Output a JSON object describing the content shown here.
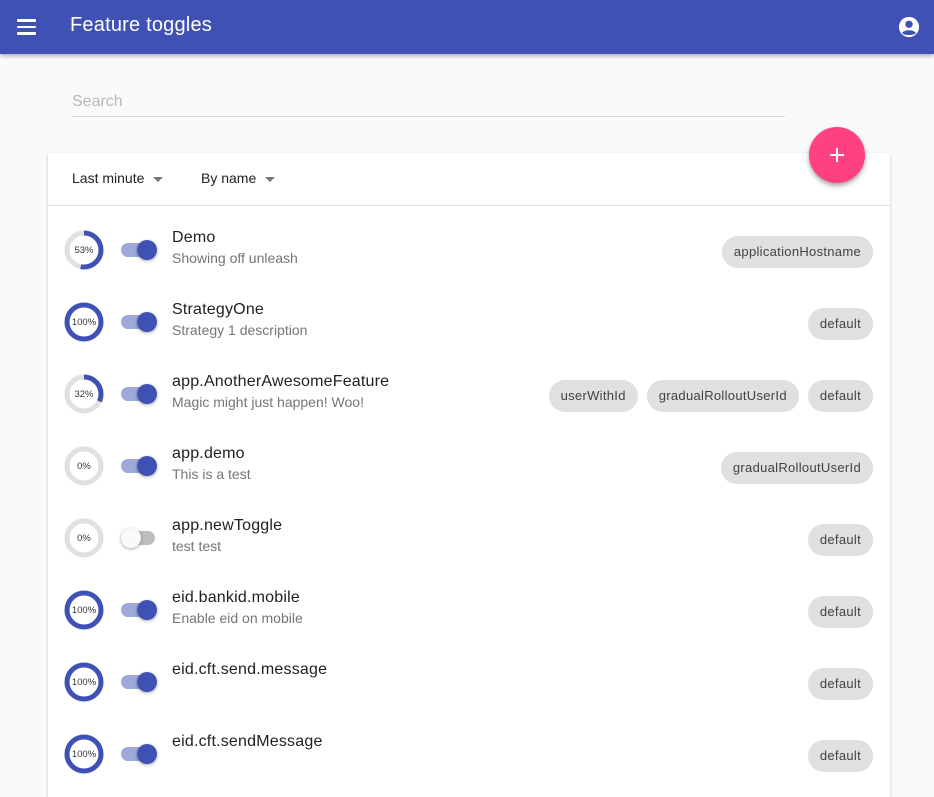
{
  "header": {
    "title": "Feature toggles",
    "menu_icon": "menu-icon",
    "account_icon": "account-circle-icon",
    "bg_color": "#3f51b5"
  },
  "search": {
    "placeholder": "Search",
    "value": ""
  },
  "filters": {
    "time_window": "Last minute",
    "sort": "By name"
  },
  "fab": {
    "icon": "plus-icon",
    "color": "#ff4081"
  },
  "toggles": [
    {
      "name": "Demo",
      "description": "Showing off unleash",
      "percent": 53,
      "percent_label": "53%",
      "enabled": true,
      "strategies": [
        "applicationHostname"
      ]
    },
    {
      "name": "StrategyOne",
      "description": "Strategy 1 description",
      "percent": 100,
      "percent_label": "100%",
      "enabled": true,
      "strategies": [
        "default"
      ]
    },
    {
      "name": "app.AnotherAwesomeFeature",
      "description": "Magic might just happen! Woo!",
      "percent": 32,
      "percent_label": "32%",
      "enabled": true,
      "strategies": [
        "userWithId",
        "gradualRolloutUserId",
        "default"
      ]
    },
    {
      "name": "app.demo",
      "description": "This is a test",
      "percent": 0,
      "percent_label": "0%",
      "enabled": true,
      "strategies": [
        "gradualRolloutUserId"
      ]
    },
    {
      "name": "app.newToggle",
      "description": "test test",
      "percent": 0,
      "percent_label": "0%",
      "enabled": false,
      "strategies": [
        "default"
      ]
    },
    {
      "name": "eid.bankid.mobile",
      "description": "Enable eid on mobile",
      "percent": 100,
      "percent_label": "100%",
      "enabled": true,
      "strategies": [
        "default"
      ]
    },
    {
      "name": "eid.cft.send.message",
      "description": "",
      "percent": 100,
      "percent_label": "100%",
      "enabled": true,
      "strategies": [
        "default"
      ]
    },
    {
      "name": "eid.cft.sendMessage",
      "description": "",
      "percent": 100,
      "percent_label": "100%",
      "enabled": true,
      "strategies": [
        "default"
      ]
    }
  ]
}
